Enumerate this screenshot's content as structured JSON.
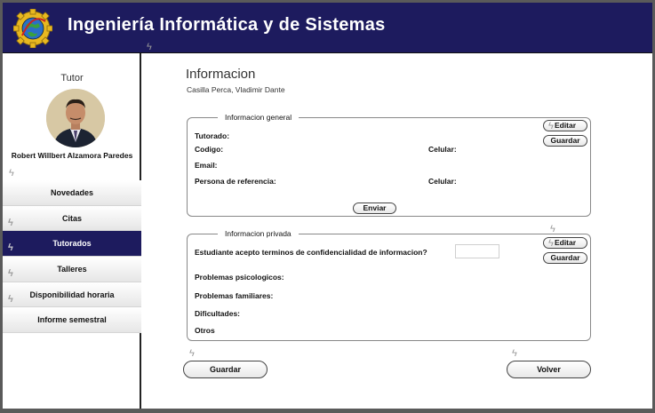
{
  "header": {
    "title": "Ingeniería Informática y de Sistemas",
    "logo_icon": "gear-globe-logo"
  },
  "sidebar": {
    "tutor_label": "Tutor",
    "tutor_name": "Robert Willbert Alzamora Paredes",
    "items": [
      {
        "label": "Novedades"
      },
      {
        "label": "Citas"
      },
      {
        "label": "Tutorados",
        "active": true
      },
      {
        "label": "Talleres"
      },
      {
        "label": "Disponibilidad horaria"
      },
      {
        "label": "Informe semestral"
      }
    ]
  },
  "main": {
    "title": "Informacion",
    "subtitle": "Casilla Perca, Vladimir Dante",
    "general": {
      "legend": "Informacion general",
      "tutorado": "Tutorado:",
      "codigo": "Codigo:",
      "celular1": "Celular:",
      "email": "Email:",
      "persona": "Persona de referencia:",
      "celular2": "Celular:",
      "edit_label": "Editar",
      "save_label": "Guardar",
      "send_label": "Enviar"
    },
    "privada": {
      "legend": "Informacion privada",
      "question": "Estudiante acepto terminos de confidencialidad de informacion?",
      "psico": "Problemas psicologicos:",
      "familiares": "Problemas familiares:",
      "dificultades": "Dificultades:",
      "otros": "Otros",
      "edit_label": "Editar",
      "save_label": "Guardar"
    },
    "bottom": {
      "save_label": "Guardar",
      "back_label": "Volver"
    }
  },
  "colors": {
    "header_bg": "#1d1b5e",
    "active_nav": "#1d1b5e"
  }
}
